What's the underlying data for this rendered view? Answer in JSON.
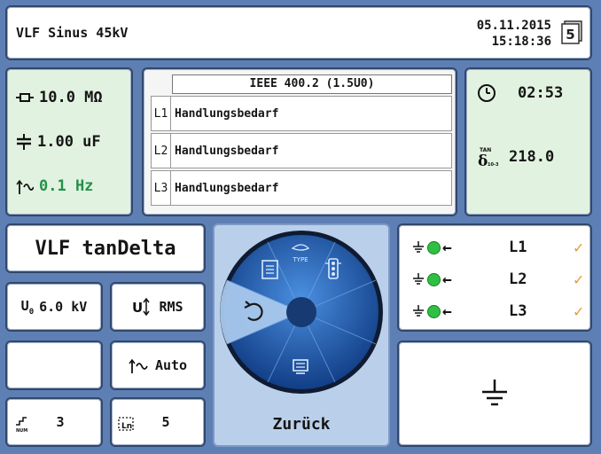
{
  "header": {
    "title": "VLF Sinus 45kV",
    "date": "05.11.2015",
    "time": "15:18:36",
    "calendar_day": "5"
  },
  "measurements": [
    {
      "icon": "resistor-icon",
      "value": "10.0 MΩ"
    },
    {
      "icon": "capacitor-icon",
      "value": "1.00 uF"
    },
    {
      "icon": "frequency-icon",
      "value": "0.1 Hz"
    }
  ],
  "status": {
    "header": "IEEE 400.2 (1.5U0)",
    "rows": [
      {
        "phase": "L1",
        "text": "Handlungsbedarf"
      },
      {
        "phase": "L2",
        "text": "Handlungsbedarf"
      },
      {
        "phase": "L3",
        "text": "Handlungsbedarf"
      }
    ]
  },
  "timer": {
    "clock_icon": "clock-icon",
    "time": "02:53",
    "tan_icon": "tan-delta-icon",
    "tan_value": "218.0"
  },
  "mode": {
    "label": "VLF tanDelta"
  },
  "voltage": {
    "symbol": "U",
    "subscript": "0",
    "value": "6.0 kV"
  },
  "rms": {
    "icon": "voltage-waveform-icon",
    "label": "RMS"
  },
  "frequency_mode": {
    "icon": "frequency-icon",
    "label": "Auto"
  },
  "num": {
    "icon": "steps-num-icon",
    "value": "3"
  },
  "ln": {
    "icon": "ln-icon",
    "value": "5"
  },
  "phases": [
    {
      "label": "L1",
      "status": "check"
    },
    {
      "label": "L2",
      "status": "check"
    },
    {
      "label": "L3",
      "status": "check"
    }
  ],
  "phase_check": "✓",
  "wheel": {
    "type_label": "TYPE",
    "items": [
      "report-icon",
      "type-icon",
      "traffic-light-icon",
      "back-rotate-icon",
      "export-icon"
    ]
  },
  "back_button": {
    "label": "Zurück"
  },
  "colors": {
    "background": "#5d7fb4",
    "panel_green": "#e2f2e0",
    "accent_green": "#22914a",
    "check_orange": "#e39a34",
    "wheel_blue": "#1f62b4"
  }
}
